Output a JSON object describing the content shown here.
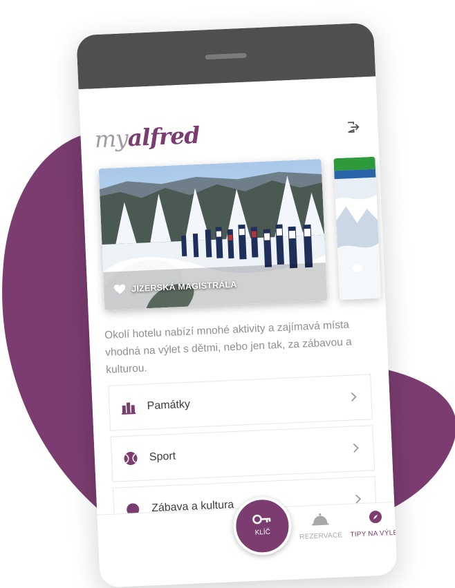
{
  "header": {
    "logo_my": "my",
    "logo_alfred": "alfred",
    "logout_icon": "logout-icon"
  },
  "carousel": {
    "cards": [
      {
        "title": "JIZERSKÁ MAGISTRÁLA",
        "icon": "heart-icon"
      }
    ]
  },
  "intro_text": "Okolí hotelu nabízí mnohé aktivity a zajímavá místa vhodná na výlet s dětmi, nebo jen tak, za zábavou a kulturou.",
  "menu": [
    {
      "label": "Památky",
      "icon": "monument-icon"
    },
    {
      "label": "Sport",
      "icon": "tennis-ball-icon"
    },
    {
      "label": "Zábava a kultura",
      "icon": "theater-icon"
    }
  ],
  "bottom_nav": {
    "key_label": "KLÍČ",
    "reservation_label": "REZERVACE",
    "tips_label": "TIPY NA VÝLET"
  },
  "colors": {
    "brand": "#7b3d70",
    "phone_frame": "#4f4f4f",
    "text_muted": "#8f8f8f"
  }
}
